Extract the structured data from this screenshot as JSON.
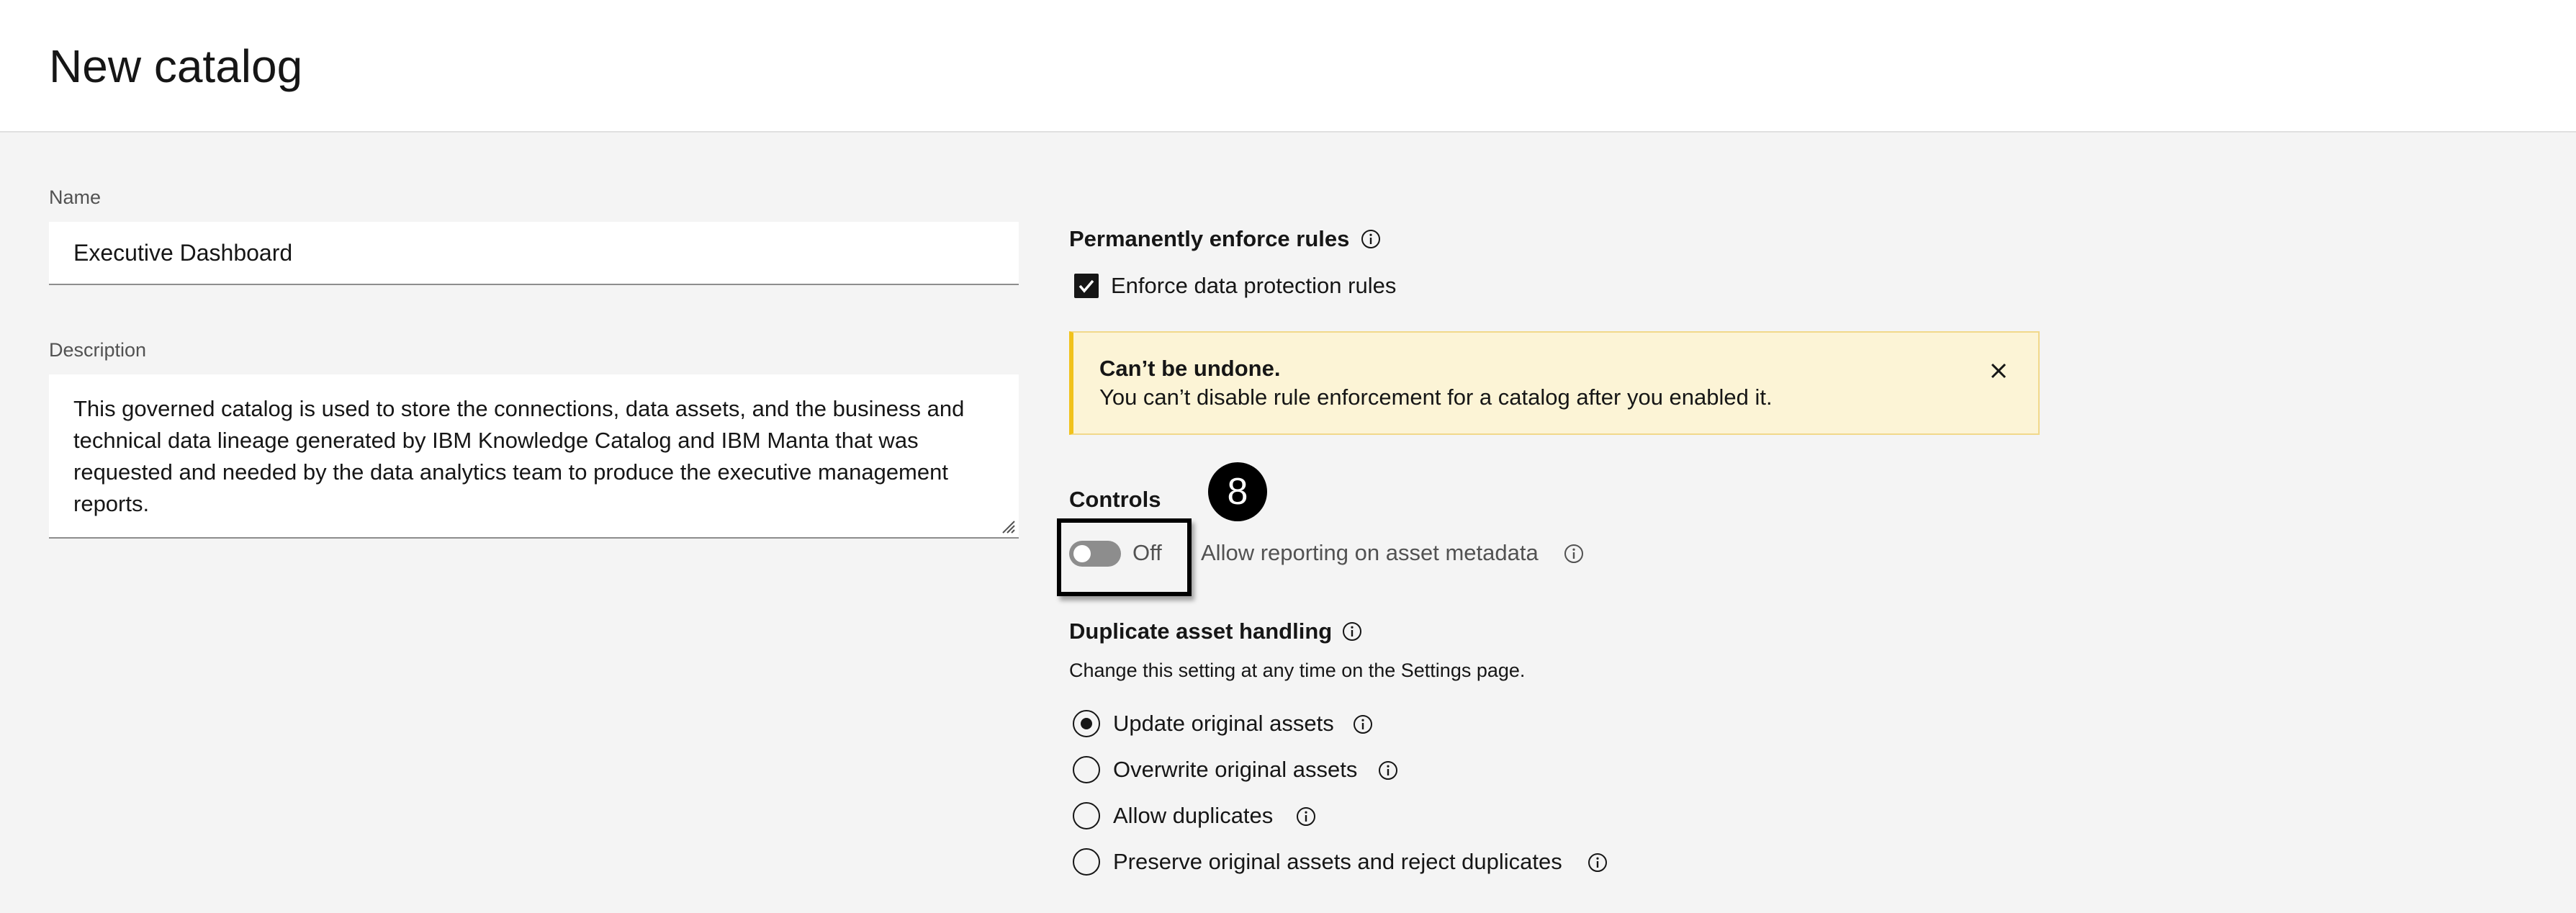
{
  "header": {
    "title": "New catalog"
  },
  "form": {
    "name_label": "Name",
    "name_value": "Executive Dashboard",
    "description_label": "Description",
    "description_value": "This governed catalog is used to store the connections, data assets, and the business and technical data lineage generated by IBM Knowledge Catalog and IBM Manta that was requested and needed by the data analytics team to produce the executive management reports."
  },
  "enforce": {
    "title": "Permanently enforce rules",
    "checkbox_label": "Enforce data protection rules",
    "checked": true
  },
  "warning": {
    "title": "Can’t be undone.",
    "body": "You can’t disable rule enforcement for a catalog after you enabled it.",
    "color": "#f1c21b"
  },
  "controls": {
    "title": "Controls",
    "toggle_state": "Off",
    "toggle_label": "Allow reporting on asset metadata",
    "step_badge": "8"
  },
  "duplicates": {
    "title": "Duplicate asset handling",
    "helper": "Change this setting at any time on the Settings page.",
    "options": [
      {
        "label": "Update original assets",
        "selected": true
      },
      {
        "label": "Overwrite original assets",
        "selected": false
      },
      {
        "label": "Allow duplicates",
        "selected": false
      },
      {
        "label": "Preserve original assets and reject duplicates",
        "selected": false
      }
    ]
  }
}
